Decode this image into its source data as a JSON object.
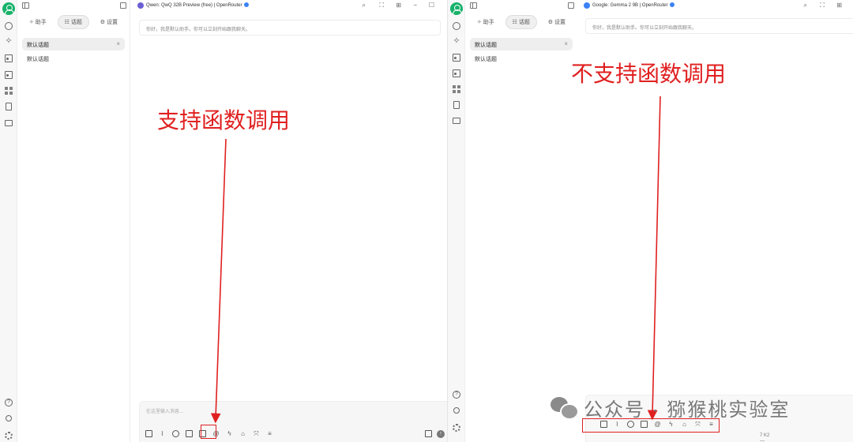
{
  "left_window": {
    "model_title": "Qwen: QwQ 32B Preview (free) | OpenRouter",
    "tabs": [
      {
        "icon": "✧",
        "label": "助手"
      },
      {
        "icon": "☷",
        "label": "话题"
      },
      {
        "icon": "⚙",
        "label": "设置"
      }
    ],
    "active_topic": "默认话题",
    "topics": [
      "默认话题"
    ],
    "welcome": "你好，我是默认助手。你可以立刻开始跟我聊天。",
    "input_placeholder": "在这里输入消息..."
  },
  "right_window": {
    "model_title": "Google: Gemma 2 9B | OpenRouter",
    "tabs": [
      {
        "icon": "✧",
        "label": "助手"
      },
      {
        "icon": "☷",
        "label": "话题"
      },
      {
        "icon": "⚙",
        "label": "设置"
      }
    ],
    "active_topic": "默认话题",
    "topics": [
      "默认话题"
    ],
    "welcome": "你好，我是默认助手。你可以立刻开始跟我聊天。",
    "below_fragments": [
      "7 K2",
      "—"
    ]
  },
  "annotations": {
    "left_label": "支持函数调用",
    "right_label": "不支持函数调用",
    "color": "#e02020"
  },
  "watermark": "公众号 · 猕猴桃实验室",
  "colors": {
    "accent_green": "#17b26a",
    "model_icon_purple": "#6b5fd3",
    "network_blue": "#3b82f6"
  }
}
